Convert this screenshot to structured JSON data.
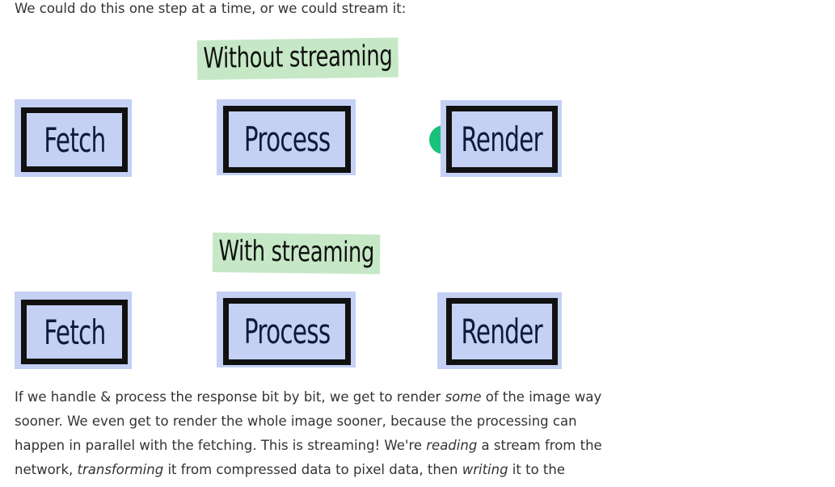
{
  "intro_text": "We could do this one step at a time, or we could stream it:",
  "diagram": {
    "without_heading": "Without streaming",
    "with_heading": "With streaming",
    "without_row": {
      "fetch": "Fetch",
      "process": "Process",
      "render": "Render"
    },
    "with_row": {
      "fetch": "Fetch",
      "process": "Process",
      "render": "Render"
    },
    "progress_marker_color": "#19c27a"
  },
  "body": {
    "line1_a": "If we handle & process the response bit by bit, we get to render ",
    "line1_em": "some",
    "line1_b": " of the image way",
    "line2": "sooner. We even get to render the whole image sooner, because the processing can",
    "line3_a": "happen in parallel with the fetching. This is streaming! We're ",
    "line3_em": "reading",
    "line3_b": " a stream from the",
    "line4_a": "network, ",
    "line4_em1": "transforming",
    "line4_b": " it from compressed data to pixel data, then ",
    "line4_em2": "writing",
    "line4_c": " it to the"
  },
  "colors": {
    "heading_highlight": "#c6e8c6",
    "box_fill": "#c4d0f4",
    "box_border": "#111111"
  }
}
